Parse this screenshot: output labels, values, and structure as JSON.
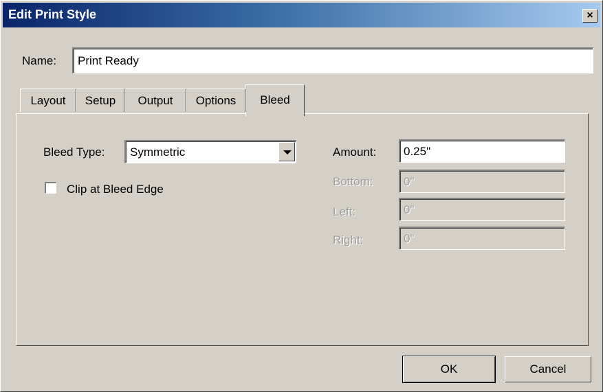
{
  "window": {
    "title": "Edit Print Style",
    "close_label": "×"
  },
  "name_field": {
    "label": "Name:",
    "value": "Print Ready"
  },
  "tabs": [
    {
      "label": "Layout"
    },
    {
      "label": "Setup"
    },
    {
      "label": "Output"
    },
    {
      "label": "Options"
    },
    {
      "label": "Bleed",
      "active": true
    }
  ],
  "bleed": {
    "type_label": "Bleed Type:",
    "type_value": "Symmetric",
    "clip_label": "Clip at Bleed Edge",
    "clip_checked": false,
    "amount_label": "Amount:",
    "amount_value": "0.25\"",
    "bottom_label": "Bottom:",
    "bottom_value": "0\"",
    "left_label": "Left:",
    "left_value": "0\"",
    "right_label": "Right:",
    "right_value": "0\""
  },
  "buttons": {
    "ok": "OK",
    "cancel": "Cancel"
  }
}
